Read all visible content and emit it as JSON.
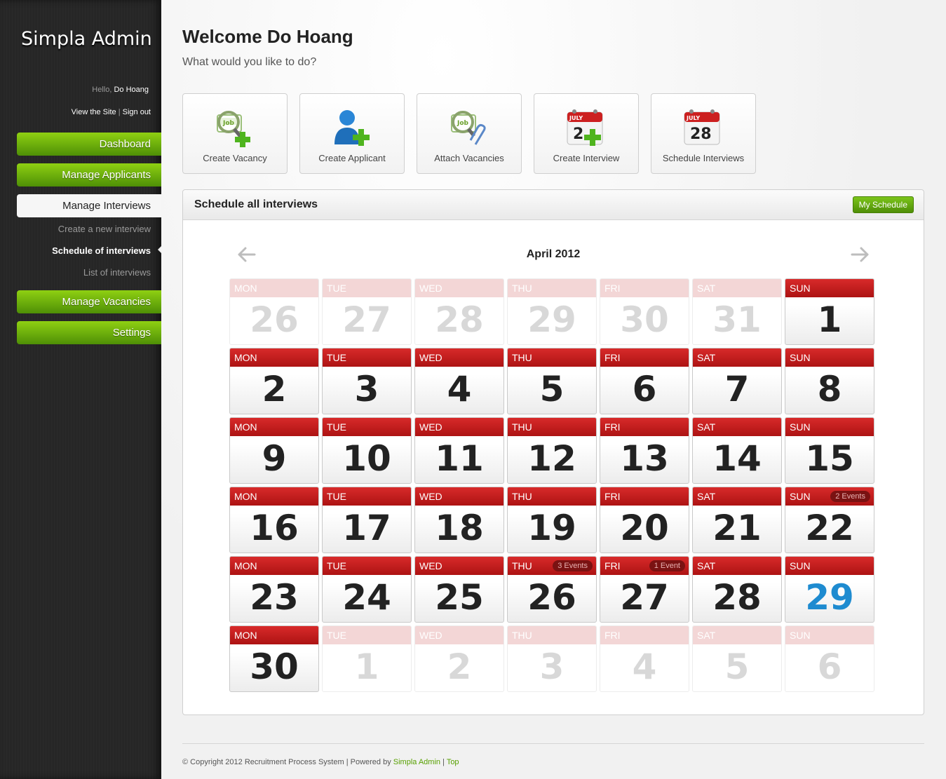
{
  "sidebar": {
    "brand": "Simpla Admin",
    "hello_prefix": "Hello, ",
    "user": "Do Hoang",
    "view_site": "View the Site",
    "sep": " | ",
    "sign_out": "Sign out",
    "nav": [
      "Dashboard",
      "Manage Applicants",
      "Manage Interviews",
      "Manage Vacancies",
      "Settings"
    ],
    "sub": [
      "Create a new interview",
      "Schedule of interviews",
      "List of interviews"
    ]
  },
  "header": {
    "welcome": "Welcome Do Hoang",
    "subtitle": "What would you like to do?"
  },
  "shortcuts": [
    {
      "label": "Create Vacancy",
      "icon": "job-search-add-icon"
    },
    {
      "label": "Create Applicant",
      "icon": "user-add-icon"
    },
    {
      "label": "Attach Vacancies",
      "icon": "job-attach-icon"
    },
    {
      "label": "Create Interview",
      "icon": "calendar-add-icon"
    },
    {
      "label": "Schedule Interviews",
      "icon": "calendar-icon"
    }
  ],
  "calendar_icon": {
    "month": "JULY",
    "day": "28",
    "day_partial": "2"
  },
  "box": {
    "title": "Schedule all interviews",
    "my_schedule": "My Schedule"
  },
  "calendar": {
    "month_label": "April 2012",
    "weekdays": [
      "MON",
      "TUE",
      "WED",
      "THU",
      "FRI",
      "SAT",
      "SUN"
    ],
    "days": [
      {
        "n": "26",
        "dim": true
      },
      {
        "n": "27",
        "dim": true
      },
      {
        "n": "28",
        "dim": true
      },
      {
        "n": "29",
        "dim": true
      },
      {
        "n": "30",
        "dim": true
      },
      {
        "n": "31",
        "dim": true
      },
      {
        "n": "1"
      },
      {
        "n": "2"
      },
      {
        "n": "3"
      },
      {
        "n": "4"
      },
      {
        "n": "5"
      },
      {
        "n": "6"
      },
      {
        "n": "7"
      },
      {
        "n": "8"
      },
      {
        "n": "9"
      },
      {
        "n": "10"
      },
      {
        "n": "11"
      },
      {
        "n": "12"
      },
      {
        "n": "13"
      },
      {
        "n": "14"
      },
      {
        "n": "15"
      },
      {
        "n": "16"
      },
      {
        "n": "17"
      },
      {
        "n": "18"
      },
      {
        "n": "19"
      },
      {
        "n": "20"
      },
      {
        "n": "21"
      },
      {
        "n": "22",
        "badge": "2 Events"
      },
      {
        "n": "23"
      },
      {
        "n": "24"
      },
      {
        "n": "25"
      },
      {
        "n": "26",
        "badge": "3 Events"
      },
      {
        "n": "27",
        "badge": "1 Event"
      },
      {
        "n": "28"
      },
      {
        "n": "29",
        "today": true
      },
      {
        "n": "30"
      },
      {
        "n": "1",
        "dim": true
      },
      {
        "n": "2",
        "dim": true
      },
      {
        "n": "3",
        "dim": true
      },
      {
        "n": "4",
        "dim": true
      },
      {
        "n": "5",
        "dim": true
      },
      {
        "n": "6",
        "dim": true
      }
    ]
  },
  "footer": {
    "copyright": "© Copyright 2012 Recruitment Process System | Powered by ",
    "powered": "Simpla Admin",
    "sep": " | ",
    "top": "Top"
  },
  "colors": {
    "accent_green": "#57a000",
    "calendar_red": "#c41e1e",
    "today_blue": "#1e8bd0"
  }
}
